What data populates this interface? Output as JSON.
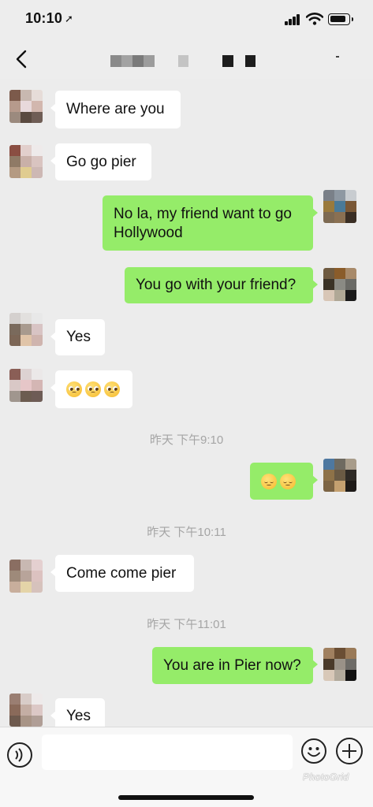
{
  "status_bar": {
    "time": "10:10",
    "location_glyph": "➚"
  },
  "nav": {
    "back_icon": "chevron-left-icon"
  },
  "messages": [
    {
      "side": "in",
      "text": "Where are you"
    },
    {
      "side": "in",
      "text": "Go go pier"
    },
    {
      "side": "out",
      "text": "No la, my friend want to go Hollywood"
    },
    {
      "side": "out",
      "text": "You go with your friend?"
    },
    {
      "side": "in",
      "text": "Yes"
    },
    {
      "side": "in",
      "emoji": [
        "pleading-face",
        "pleading-face",
        "pleading-face"
      ]
    },
    {
      "side": "out",
      "emoji": [
        "pensive-face",
        "pensive-face"
      ]
    },
    {
      "side": "in",
      "text": "Come come pier"
    },
    {
      "side": "out",
      "text": "You are in Pier now?"
    },
    {
      "side": "in",
      "text": "Yes"
    }
  ],
  "timestamps": [
    "昨天 下午9:10",
    "昨天 下午10:11",
    "昨天 下午11:01"
  ],
  "input_bar": {
    "message_value": "",
    "icons": [
      "voice-icon",
      "emoji-icon",
      "plus-icon"
    ]
  },
  "watermark": "PhotoGrid",
  "colors": {
    "background": "#ececec",
    "incoming_bubble": "#ffffff",
    "outgoing_bubble": "#95ec69",
    "timestamp": "#a5a5a5"
  }
}
